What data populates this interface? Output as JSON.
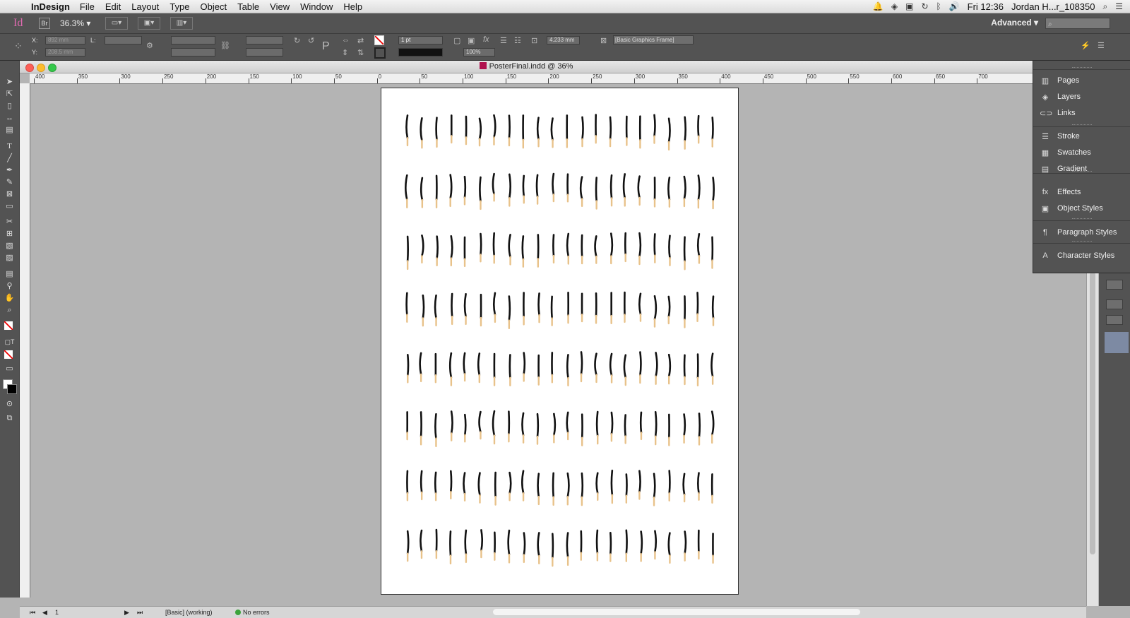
{
  "menubar": {
    "app_name": "InDesign",
    "items": [
      "File",
      "Edit",
      "Layout",
      "Type",
      "Object",
      "Table",
      "View",
      "Window",
      "Help"
    ],
    "clock": "Fri 12:36",
    "user": "Jordan H...r_108350"
  },
  "appbar": {
    "logo": "Id",
    "bridge": "Br",
    "zoom": "36.3%",
    "workspace": "Advanced"
  },
  "control": {
    "x_label": "X:",
    "y_label": "Y:",
    "x_value": "892 mm",
    "y_value": "208.5 mm",
    "l_label": "L:",
    "stroke_weight": "1 pt",
    "opacity": "100%",
    "dimension": "4.233 mm",
    "object_style": "[Basic Graphics Frame]"
  },
  "document": {
    "title": "PosterFinal.indd @ 36%",
    "ruler_labels": [
      "400",
      "350",
      "300",
      "250",
      "200",
      "150",
      "100",
      "50",
      "0",
      "50",
      "100",
      "150",
      "200",
      "250",
      "300",
      "350",
      "400",
      "450",
      "500",
      "550",
      "600",
      "650",
      "700"
    ]
  },
  "status": {
    "page": "1",
    "style": "[Basic] (working)",
    "preflight": "No errors"
  },
  "panels": {
    "items": [
      {
        "label": "Pages",
        "icon": "pages-icon",
        "glyph": "▥"
      },
      {
        "label": "Layers",
        "icon": "layers-icon",
        "glyph": "◈"
      },
      {
        "label": "Links",
        "icon": "links-icon",
        "glyph": "⊂⊃"
      },
      {
        "label": "Stroke",
        "icon": "stroke-icon",
        "glyph": "☰"
      },
      {
        "label": "Swatches",
        "icon": "swatches-icon",
        "glyph": "▦"
      },
      {
        "label": "Gradient",
        "icon": "gradient-icon",
        "glyph": "▤"
      },
      {
        "label": "Effects",
        "icon": "effects-icon",
        "glyph": "fx"
      },
      {
        "label": "Object Styles",
        "icon": "object-styles-icon",
        "glyph": "▣"
      },
      {
        "label": "Paragraph Styles",
        "icon": "paragraph-styles-icon",
        "glyph": "¶"
      },
      {
        "label": "Character Styles",
        "icon": "character-styles-icon",
        "glyph": "A"
      }
    ]
  },
  "colors": {
    "ui_dark": "#535353",
    "pasteboard": "#b4b4b4",
    "match_tip": "#e8c28a",
    "match_stick": "#111111",
    "preflight_ok": "#3ba33b"
  }
}
